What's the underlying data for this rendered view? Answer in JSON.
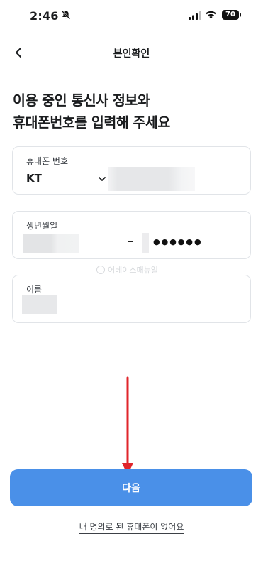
{
  "status_bar": {
    "time": "2:46",
    "battery": "70"
  },
  "header": {
    "title": "본인확인"
  },
  "headline": {
    "line1": "이용 중인 통신사 정보와",
    "line2": "휴대폰번호를 입력해 주세요"
  },
  "phone_field": {
    "label": "휴대폰 번호",
    "carrier": "KT"
  },
  "birth_field": {
    "label": "생년월일",
    "separator": "–",
    "masked": "●●●●●●"
  },
  "name_field": {
    "label": "이름"
  },
  "watermark": "어베이스매뉴얼",
  "footer": {
    "next_label": "다음",
    "no_phone_link": "내 명의로 된 휴대폰이 없어요"
  },
  "colors": {
    "primary": "#4a90e8",
    "annotation_arrow": "#e0252b"
  }
}
